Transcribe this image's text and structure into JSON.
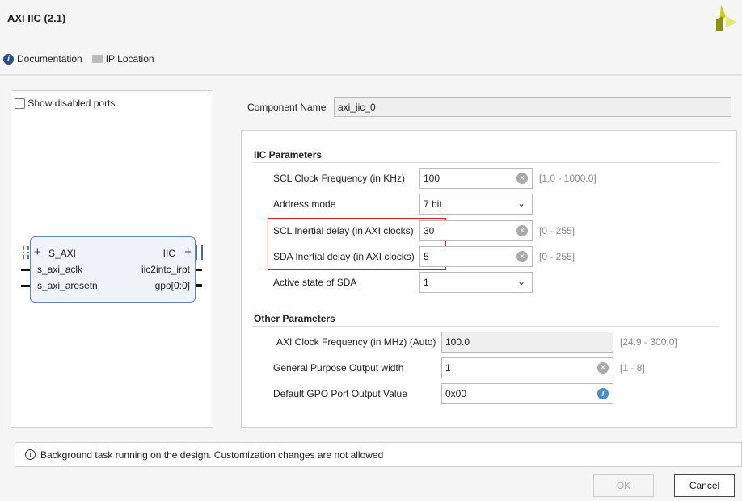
{
  "title": "AXI IIC (2.1)",
  "toolbar": {
    "documentation": "Documentation",
    "ip_location": "IP Location"
  },
  "left": {
    "show_disabled_ports": "Show disabled ports",
    "ports_left": [
      "S_AXI",
      "s_axi_aclk",
      "s_axi_aresetn"
    ],
    "ports_right": [
      "IIC",
      "iic2intc_irpt",
      "gpo[0:0]"
    ]
  },
  "component": {
    "label": "Component Name",
    "value": "axi_iic_0"
  },
  "iic": {
    "header": "IIC Parameters",
    "fields": [
      {
        "label": "SCL Clock Frequency (in KHz)",
        "value": "100",
        "range": "[1.0 - 1000.0]"
      },
      {
        "label": "Address mode",
        "value": "7 bit"
      },
      {
        "label": "SCL Inertial delay (in AXI clocks)",
        "value": "30",
        "range": "[0 - 255]"
      },
      {
        "label": "SDA Inertial delay (in AXI clocks)",
        "value": "5",
        "range": "[0 - 255]"
      },
      {
        "label": "Active state of SDA",
        "value": "1"
      }
    ]
  },
  "other": {
    "header": "Other Parameters",
    "fields": [
      {
        "label": "AXI Clock Frequency (in MHz) (Auto)",
        "value": "100.0",
        "range": "[24.9 - 300.0]"
      },
      {
        "label": "General Purpose Output width",
        "value": "1",
        "range": "[1 - 8]"
      },
      {
        "label": "Default GPO Port Output Value",
        "value": "0x00"
      }
    ]
  },
  "status": "Background task running on the design. Customization changes are not allowed",
  "buttons": {
    "ok": "OK",
    "cancel": "Cancel"
  },
  "colors": {
    "highlight": "#e02020",
    "logo": "#c8d400"
  }
}
